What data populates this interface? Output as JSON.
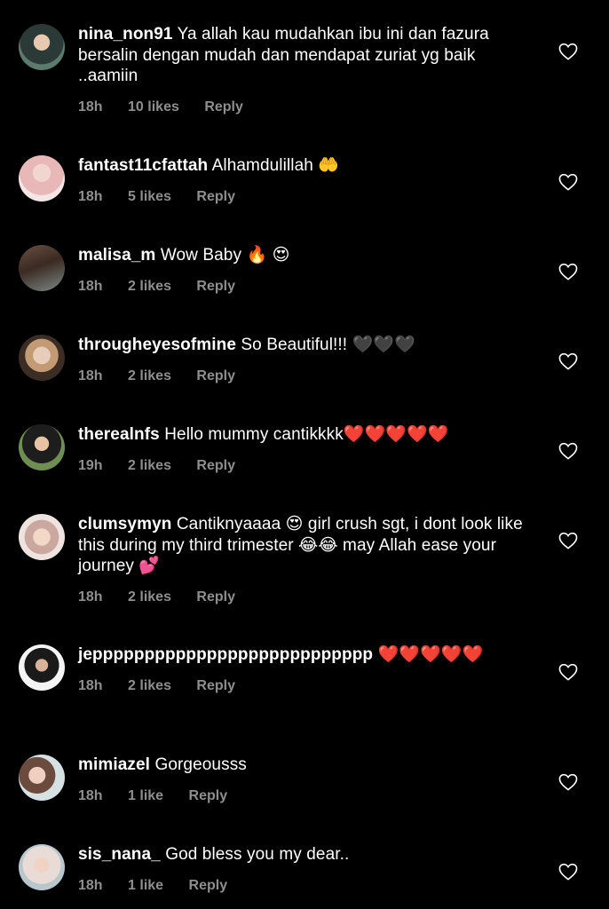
{
  "colors": {
    "background": "#000000",
    "text": "#ffffff",
    "meta": "#8e8e8e"
  },
  "comments": [
    {
      "username": "nina_non91",
      "text": "Ya allah kau mudahkan ibu ini dan fazura bersalin dengan mudah dan mendapat zuriat yg baik ..aamiin",
      "time": "18h",
      "likes": "10 likes",
      "reply": "Reply"
    },
    {
      "username": "fantast11cfattah",
      "text": "Alhamdulillah 🤲",
      "time": "18h",
      "likes": "5 likes",
      "reply": "Reply"
    },
    {
      "username": "malisa_m",
      "text": "Wow Baby 🔥 😍",
      "time": "18h",
      "likes": "2 likes",
      "reply": "Reply"
    },
    {
      "username": "througheyesofmine",
      "text": "So Beautiful!!! 🖤🖤🖤",
      "time": "18h",
      "likes": "2 likes",
      "reply": "Reply"
    },
    {
      "username": "therealnfs",
      "text": "Hello mummy cantikkkk❤️❤️❤️❤️❤️",
      "time": "19h",
      "likes": "2 likes",
      "reply": "Reply"
    },
    {
      "username": "clumsymyn",
      "text": "Cantiknyaaaa 😍 girl crush sgt, i dont look like this during my third trimester 😂😂 may Allah ease your journey 💕",
      "time": "18h",
      "likes": "2 likes",
      "reply": "Reply"
    },
    {
      "username": "jeppppppppppppppppppppppppppp",
      "text": "❤️❤️❤️❤️❤️",
      "time": "18h",
      "likes": "2 likes",
      "reply": "Reply"
    },
    {
      "username": "mimiazel",
      "text": "Gorgeousss",
      "time": "18h",
      "likes": "1 like",
      "reply": "Reply"
    },
    {
      "username": "sis_nana_",
      "text": "God bless you my dear..",
      "time": "18h",
      "likes": "1 like",
      "reply": "Reply"
    }
  ]
}
